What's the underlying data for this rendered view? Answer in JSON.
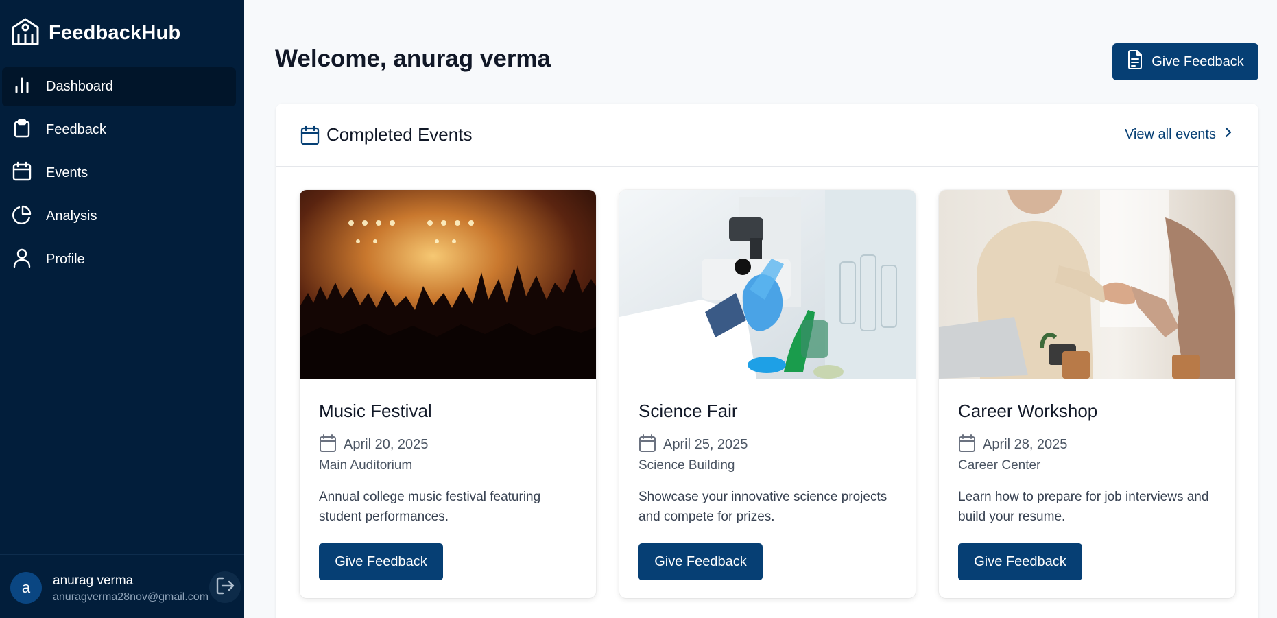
{
  "app": {
    "name": "FeedbackHub"
  },
  "sidebar": {
    "items": [
      {
        "label": "Dashboard",
        "icon": "bar-chart-icon",
        "active": true
      },
      {
        "label": "Feedback",
        "icon": "clipboard-icon",
        "active": false
      },
      {
        "label": "Events",
        "icon": "calendar-icon",
        "active": false
      },
      {
        "label": "Analysis",
        "icon": "pie-chart-icon",
        "active": false
      },
      {
        "label": "Profile",
        "icon": "user-icon",
        "active": false
      }
    ],
    "user": {
      "initial": "a",
      "name": "anurag verma",
      "email": "anuragverma28nov@gmail.com"
    }
  },
  "header": {
    "welcome": "Welcome, anurag verma",
    "give_feedback_label": "Give Feedback"
  },
  "events_panel": {
    "title": "Completed Events",
    "view_all_label": "View all events",
    "events": [
      {
        "title": "Music Festival",
        "date": "April 20, 2025",
        "venue": "Main Auditorium",
        "description": "Annual college music festival featuring student performances.",
        "button_label": "Give Feedback",
        "image": "concert-crowd-photo"
      },
      {
        "title": "Science Fair",
        "date": "April 25, 2025",
        "venue": "Science Building",
        "description": "Showcase your innovative science projects and compete for prizes.",
        "button_label": "Give Feedback",
        "image": "laboratory-photo"
      },
      {
        "title": "Career Workshop",
        "date": "April 28, 2025",
        "venue": "Career Center",
        "description": "Learn how to prepare for job interviews and build your resume.",
        "button_label": "Give Feedback",
        "image": "handshake-photo"
      }
    ]
  },
  "colors": {
    "sidebar_bg": "#021e3b",
    "primary": "#063f74",
    "page_bg": "#f7f9fb"
  }
}
